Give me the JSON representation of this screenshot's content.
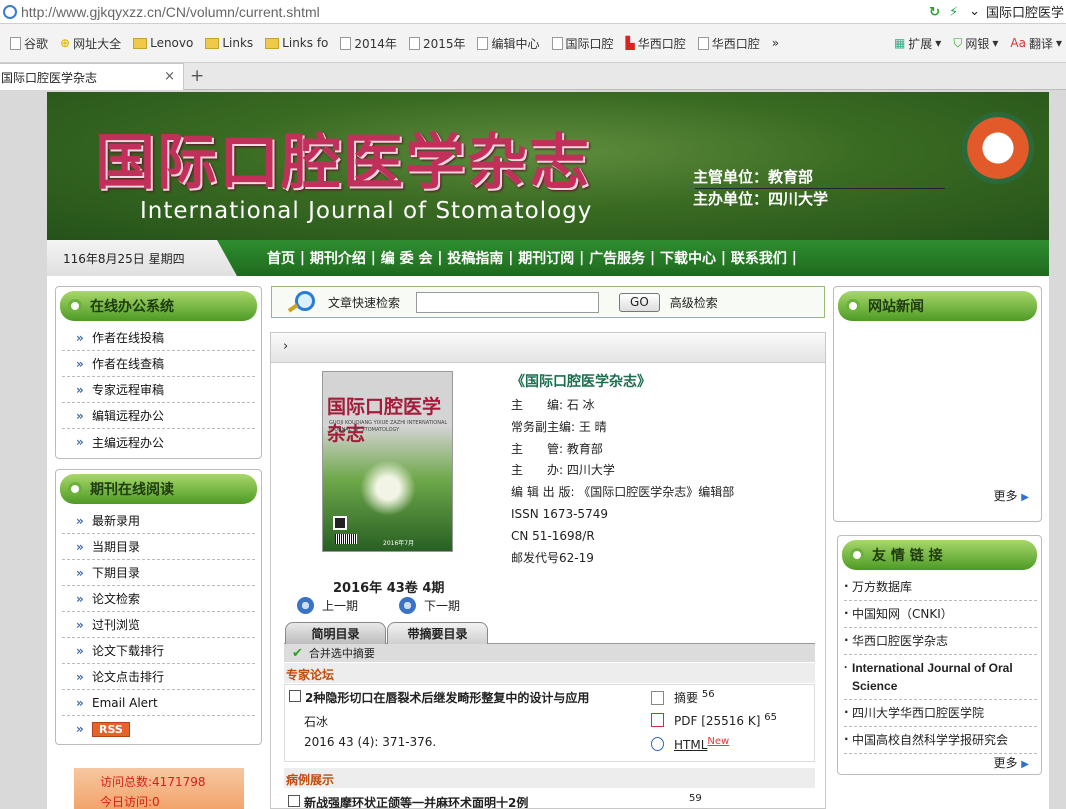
{
  "browser": {
    "url": "http://www.gjkqyxzz.cn/CN/volumn/current.shtml",
    "site_title": "国际口腔医学",
    "bookmarks": [
      "谷歌",
      "网址大全",
      "Lenovo",
      "Links",
      "Links fo",
      "2014年",
      "2015年",
      "编辑中心",
      "国际口腔",
      "华西口腔",
      "华西口腔"
    ],
    "more": "»",
    "extensions": [
      "扩展",
      "网银",
      "翻译"
    ],
    "tab_title": "国际口腔医学杂志",
    "tab_close": "×",
    "new_tab": "+"
  },
  "banner": {
    "title_cn": "国际口腔医学杂志",
    "title_en": "International Journal of Stomatology",
    "sponsor_1": "主管单位：教育部",
    "sponsor_2": "主办单位：四川大学"
  },
  "nav": {
    "date": "116年8月25日 星期四",
    "items": [
      "首页",
      "期刊介绍",
      "编 委 会",
      "投稿指南",
      "期刊订阅",
      "广告服务",
      "下载中心",
      "联系我们"
    ],
    "sep": " | "
  },
  "left": {
    "office_title": "在线办公系统",
    "office_items": [
      "作者在线投稿",
      "作者在线查稿",
      "专家远程审稿",
      "编辑远程办公",
      "主编远程办公"
    ],
    "read_title": "期刊在线阅读",
    "read_items": [
      "最新录用",
      "当期目录",
      "下期目录",
      "论文检索",
      "过刊浏览",
      "论文下载排行",
      "论文点击排行",
      "Email Alert"
    ],
    "rss": "RSS",
    "visit_total": "访问总数:4171798",
    "visit_today": "今日访问:0"
  },
  "search": {
    "label": "文章快速检索",
    "value": "",
    "go": "GO",
    "advanced": "高级检索"
  },
  "content": {
    "breadcrumb_arrow": "›",
    "cover": {
      "title": "国际口腔医学杂志",
      "subtitle": "GUOJI KOUQIANG YIXUE ZAZHI INTERNATIONAL JOURNAL OF STOMATOLOGY",
      "date": "2016年7月"
    },
    "journal_title": "《国际口腔医学杂志》",
    "info": [
      "主　　编: 石 冰",
      "常务副主编: 王 晴",
      "主　　管: 教育部",
      "主　　办: 四川大学",
      "编 辑 出 版: 《国际口腔医学杂志》编辑部",
      "ISSN 1673-5749",
      "CN 51-1698/R",
      "邮发代号62-19"
    ],
    "issue": "2016年 43卷 4期",
    "prev": "上一期",
    "next": "下一期",
    "tab_simple": "简明目录",
    "tab_abstract": "带摘要目录",
    "merge": "合并选中摘要",
    "section_1": "专家论坛",
    "article": {
      "title": "2种隐形切口在唇裂术后继发畸形整复中的设计与应用",
      "author": "石冰",
      "citation": "2016 43 (4): 371-376.",
      "abstract_label": "摘要",
      "abstract_count": "56",
      "pdf_label": "PDF [25516 K]",
      "pdf_count": "65",
      "html_label": "HTML",
      "new_label": "New"
    },
    "section_2": "病例展示",
    "article2_title": "新战强摩环状正颌等一并麻环术面明十2例",
    "article2_abstract_count": "59"
  },
  "right": {
    "news_title": "网站新闻",
    "more": "更多",
    "links_title": "友 情 链 接",
    "links": [
      "万方数据库",
      "中国知网（CNKI）",
      "华西口腔医学杂志",
      "International Journal of Oral Science",
      "四川大学华西口腔医学院",
      "中国高校自然科学学报研究会"
    ]
  }
}
